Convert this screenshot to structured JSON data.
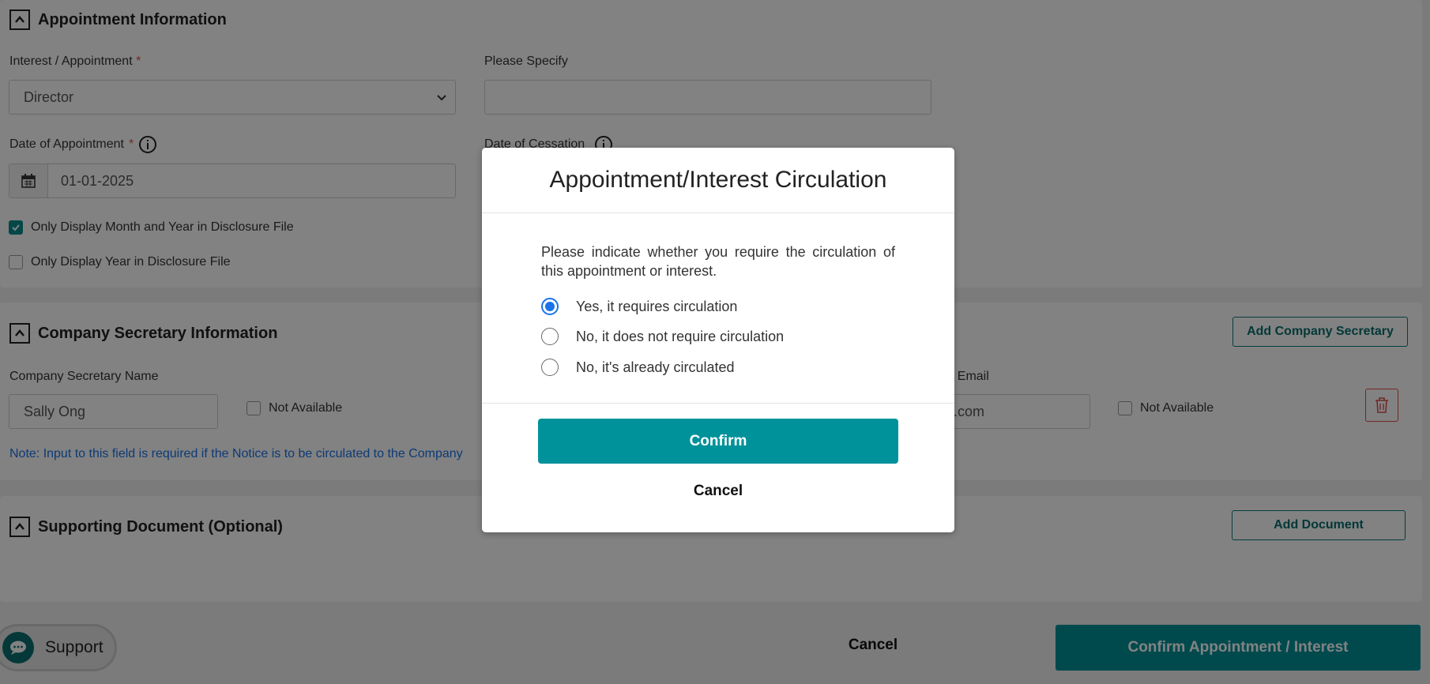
{
  "appointment": {
    "section_title": "Appointment Information",
    "interest_label": "Interest / Appointment",
    "interest_required": "*",
    "interest_value": "Director",
    "specify_label": "Please Specify",
    "specify_value": "",
    "doa_label": "Date of Appointment",
    "doa_required": "*",
    "doa_value": "01-01-2025",
    "doc_label": "Date of Cessation",
    "check_month_year_label": "Only Display Month and Year in Disclosure File",
    "check_month_year_checked": true,
    "check_year_label": "Only Display Year in Disclosure File",
    "check_year_checked": false
  },
  "secretary": {
    "section_title": "Company Secretary Information",
    "add_button": "Add Company Secretary",
    "name_label": "Company Secretary Name",
    "name_value": "Sally Ong",
    "name_not_available": "Not Available",
    "email_label": "r Email",
    "email_value": "il.com",
    "email_not_available": "Not Available",
    "note": "Note: Input to this field is required if the Notice is to be circulated to the Company"
  },
  "documents": {
    "section_title": "Supporting Document (Optional)",
    "add_button": "Add Document"
  },
  "footer": {
    "support_label": "Support",
    "cancel_label": "Cancel",
    "confirm_label": "Confirm Appointment / Interest"
  },
  "modal": {
    "title": "Appointment/Interest Circulation",
    "text": "Please indicate whether you require the circulation of this appointment or interest.",
    "options": [
      {
        "label": "Yes, it requires circulation",
        "selected": true
      },
      {
        "label": "No, it does not require circulation",
        "selected": false
      },
      {
        "label": "No, it's already circulated",
        "selected": false
      }
    ],
    "confirm_label": "Confirm",
    "cancel_label": "Cancel"
  },
  "colors": {
    "accent": "#00929a",
    "radio_selected": "#1a73e8",
    "required": "#d9534f",
    "note": "#1a73e8"
  }
}
